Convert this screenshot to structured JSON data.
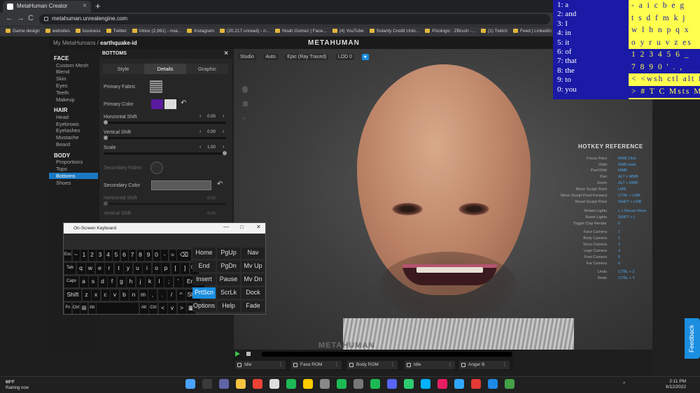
{
  "browser": {
    "tab_title": "MetaHuman Creator",
    "new_tab": "+",
    "close_tab": "×",
    "url": "metahuman.unrealengine.com",
    "nav_back": "←",
    "nav_forward": "→",
    "nav_reload": "C",
    "bookmarks": [
      "Game design",
      "websites",
      "business",
      "Twitter",
      "Inbox (2,961) - noa...",
      "Instagram",
      "(20,217 unread) - n...",
      "Noah Gomez | Face...",
      "(4) YouTube",
      "Solarity Credit Unio...",
      "Pixologic : ZBrush -...",
      "(1) Twitch",
      "Feed | LinkedIn"
    ]
  },
  "app": {
    "breadcrumb_root": "My MetaHumans /",
    "breadcrumb_current": "earthquake-id",
    "logo_text": "METAHUMAN",
    "watermark": "METAHUMAN"
  },
  "left_nav": {
    "sections": [
      {
        "title": "FACE",
        "items": [
          "Custom Mesh",
          "Blend",
          "Skin",
          "Eyes",
          "Teeth",
          "Makeup"
        ]
      },
      {
        "title": "HAIR",
        "items": [
          "Head",
          "Eyebrows",
          "Eyelashes",
          "Mustache",
          "Beard"
        ]
      },
      {
        "title": "BODY",
        "items": [
          "Proportions",
          "Tops",
          "Bottoms",
          "Shoes"
        ]
      }
    ],
    "active_item": "Bottoms"
  },
  "panel": {
    "title": "BOTTOMS",
    "tabs": [
      "Style",
      "Details",
      "Graphic"
    ],
    "active_tab": "Details",
    "primary_fabric_label": "Primary Fabric",
    "primary_color_label": "Primary Color",
    "primary_color_swatch": "#5a1aa0",
    "primary_color_swatch2": "#dddddd",
    "horizontal_shift_label": "Horizontal Shift",
    "horizontal_shift_value": "0.00",
    "vertical_shift_label": "Vertical Shift",
    "vertical_shift_value": "0.00",
    "scale_label": "Scale",
    "scale_value": "1.00",
    "secondary_fabric_label": "Secondary Fabric",
    "secondary_color_label": "Secondary Color",
    "horizontal_shift2_label": "Horizontal Shift",
    "horizontal_shift2_value": "0.00",
    "vertical_shift2_label": "Vertical Shift",
    "vertical_shift2_value": "0.00",
    "stepper_left": "‹",
    "stepper_right": "›",
    "reset_glyph": "↶"
  },
  "viewport": {
    "tools": [
      "Studio",
      "Auto",
      "Epic (Ray Traced)",
      "LOD 0"
    ]
  },
  "hotkeys": {
    "title": "HOTKEY REFERENCE",
    "rows": [
      {
        "action": "Focus Point",
        "key": "RMB Click"
      },
      {
        "action": "Orbit",
        "key": "RMB Hold"
      },
      {
        "action": "Pan/Orbit",
        "key": "MMB"
      },
      {
        "action": "Pan",
        "key": "ALT + MMB"
      },
      {
        "action": "Zoom",
        "key": "ALT + RMB"
      },
      {
        "action": "Move Sculpt Point",
        "key": "LMB"
      },
      {
        "action": "Move Sculpt Point Forward",
        "key": "CTRL + LMB"
      },
      {
        "action": "Reset Sculpt Point",
        "key": "SHIFT + LMB"
      },
      {
        "action": "Rotate Lights",
        "key": "L + Mouse Move"
      },
      {
        "action": "Reset Lights",
        "key": "SHIFT + L"
      },
      {
        "action": "Toggle Clay Render",
        "key": "0"
      },
      {
        "action": "Face Camera",
        "key": "1"
      },
      {
        "action": "Body Camera",
        "key": "2"
      },
      {
        "action": "Torso Camera",
        "key": "3"
      },
      {
        "action": "Legs Camera",
        "key": "4"
      },
      {
        "action": "Feet Camera",
        "key": "5"
      },
      {
        "action": "Far Camera",
        "key": "6"
      },
      {
        "action": "Undo",
        "key": "CTRL + Z"
      },
      {
        "action": "Redo",
        "key": "CTRL + Y"
      }
    ]
  },
  "overlay": {
    "words": [
      "1: a",
      "2: and",
      "3: I",
      "4: in",
      "5: it",
      "6: of",
      "7: that",
      "8: the",
      "9: to",
      "0: you"
    ],
    "star": "*",
    "keys_rows": [
      "- a i c b e g",
      "t s d f m k j",
      "w l h n p q x",
      "o y r u v z es",
      "1 2 3 4 5 6 _",
      "7 8 9 0 ' . ,",
      "< <wsh ctl alt fn tb",
      "> # T C Msts M"
    ]
  },
  "timeline": {
    "tracks": [
      "Idle",
      "Face ROM",
      "Body ROM",
      "Idle",
      "Anger B"
    ],
    "menu_glyph": "⋮"
  },
  "feedback": "Feedback",
  "osk": {
    "title": "On-Screen Keyboard",
    "min": "—",
    "max": "□",
    "close": "✕",
    "row1": [
      "Esc",
      "~",
      "1",
      "2",
      "3",
      "4",
      "5",
      "6",
      "7",
      "8",
      "9",
      "0",
      "-",
      "=",
      "⌫"
    ],
    "row2": [
      "Tab",
      "q",
      "w",
      "e",
      "r",
      "t",
      "y",
      "u",
      "i",
      "o",
      "p",
      "[",
      "]",
      "Del"
    ],
    "row3": [
      "Caps",
      "a",
      "s",
      "d",
      "f",
      "g",
      "h",
      "j",
      "k",
      "l",
      ";",
      "'",
      "Enter"
    ],
    "row4": [
      "Shift",
      "z",
      "x",
      "c",
      "v",
      "b",
      "n",
      "m",
      ",",
      ".",
      "/",
      "^",
      "Shift"
    ],
    "row5": [
      "Fn",
      "Ctrl",
      "⊞",
      "Alt",
      "",
      "Alt",
      "Ctrl",
      "<",
      "v",
      ">",
      "▦"
    ],
    "fn_keys": [
      "Home",
      "PgUp",
      "Nav",
      "End",
      "PgDn",
      "Mv Up",
      "Insert",
      "Pause",
      "Mv Dn",
      "PrtScn",
      "ScrLk",
      "Dock",
      "Options",
      "Help",
      "Fade"
    ],
    "highlight": "PrtScn"
  },
  "taskbar": {
    "temp": "69°F",
    "weather": "Raining now",
    "time": "2:11 PM",
    "date": "6/12/2022",
    "tray": "^"
  }
}
